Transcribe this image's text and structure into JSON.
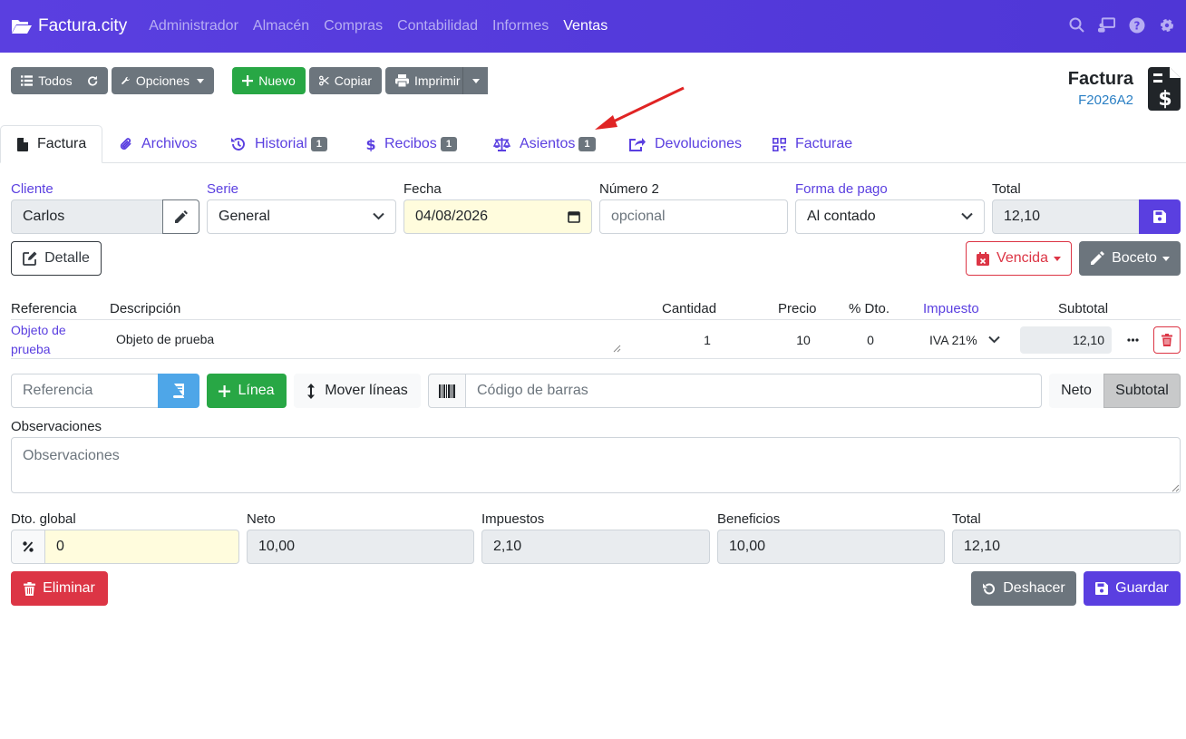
{
  "navbar": {
    "brand": "Factura.city",
    "links": [
      "Administrador",
      "Almacén",
      "Compras",
      "Contabilidad",
      "Informes",
      "Ventas"
    ],
    "icons": [
      "search-icon",
      "presentation-icon",
      "help-icon",
      "gear-icon"
    ]
  },
  "toolbar": {
    "todos": "Todos",
    "opciones": "Opciones",
    "nuevo": "Nuevo",
    "copiar": "Copiar",
    "imprimir": "Imprimir"
  },
  "doc": {
    "title": "Factura",
    "code": "F2026A2"
  },
  "tabs": [
    {
      "label": "Factura"
    },
    {
      "label": "Archivos"
    },
    {
      "label": "Historial",
      "badge": "1"
    },
    {
      "label": "Recibos",
      "badge": "1"
    },
    {
      "label": "Asientos",
      "badge": "1"
    },
    {
      "label": "Devoluciones"
    },
    {
      "label": "Facturae"
    }
  ],
  "form": {
    "cliente_label": "Cliente",
    "cliente_value": "Carlos",
    "serie_label": "Serie",
    "serie_value": "General",
    "fecha_label": "Fecha",
    "fecha_value": "04/08/2026",
    "numero2_label": "Número 2",
    "numero2_placeholder": "opcional",
    "forma_pago_label": "Forma de pago",
    "forma_pago_value": "Al contado",
    "total_label": "Total",
    "total_value": "12,10",
    "detalle": "Detalle",
    "vencida": "Vencida",
    "boceto": "Boceto"
  },
  "lines": {
    "headers": [
      "Referencia",
      "Descripción",
      "Cantidad",
      "Precio",
      "% Dto.",
      "Impuesto",
      "Subtotal"
    ],
    "rows": [
      {
        "referencia": "Objeto de prueba",
        "descripcion": "Objeto de prueba",
        "cantidad": "1",
        "precio": "10",
        "dto": "0",
        "impuesto": "IVA 21%",
        "subtotal": "12,10"
      }
    ]
  },
  "add": {
    "referencia_placeholder": "Referencia",
    "linea": "Línea",
    "mover": "Mover líneas",
    "barcode_placeholder": "Código de barras",
    "neto": "Neto",
    "subtotal": "Subtotal"
  },
  "observaciones": {
    "label": "Observaciones",
    "placeholder": "Observaciones"
  },
  "totals": {
    "dto_label": "Dto. global",
    "dto_value": "0",
    "neto_label": "Neto",
    "neto_value": "10,00",
    "impuestos_label": "Impuestos",
    "impuestos_value": "2,10",
    "beneficios_label": "Beneficios",
    "beneficios_value": "10,00",
    "total_label": "Total",
    "total_value": "12,10"
  },
  "actions": {
    "eliminar": "Eliminar",
    "deshacer": "Deshacer",
    "guardar": "Guardar"
  },
  "colors": {
    "primary": "#5a3fe0",
    "success": "#28a745",
    "danger": "#dc3545",
    "secondary": "#6c757d"
  }
}
